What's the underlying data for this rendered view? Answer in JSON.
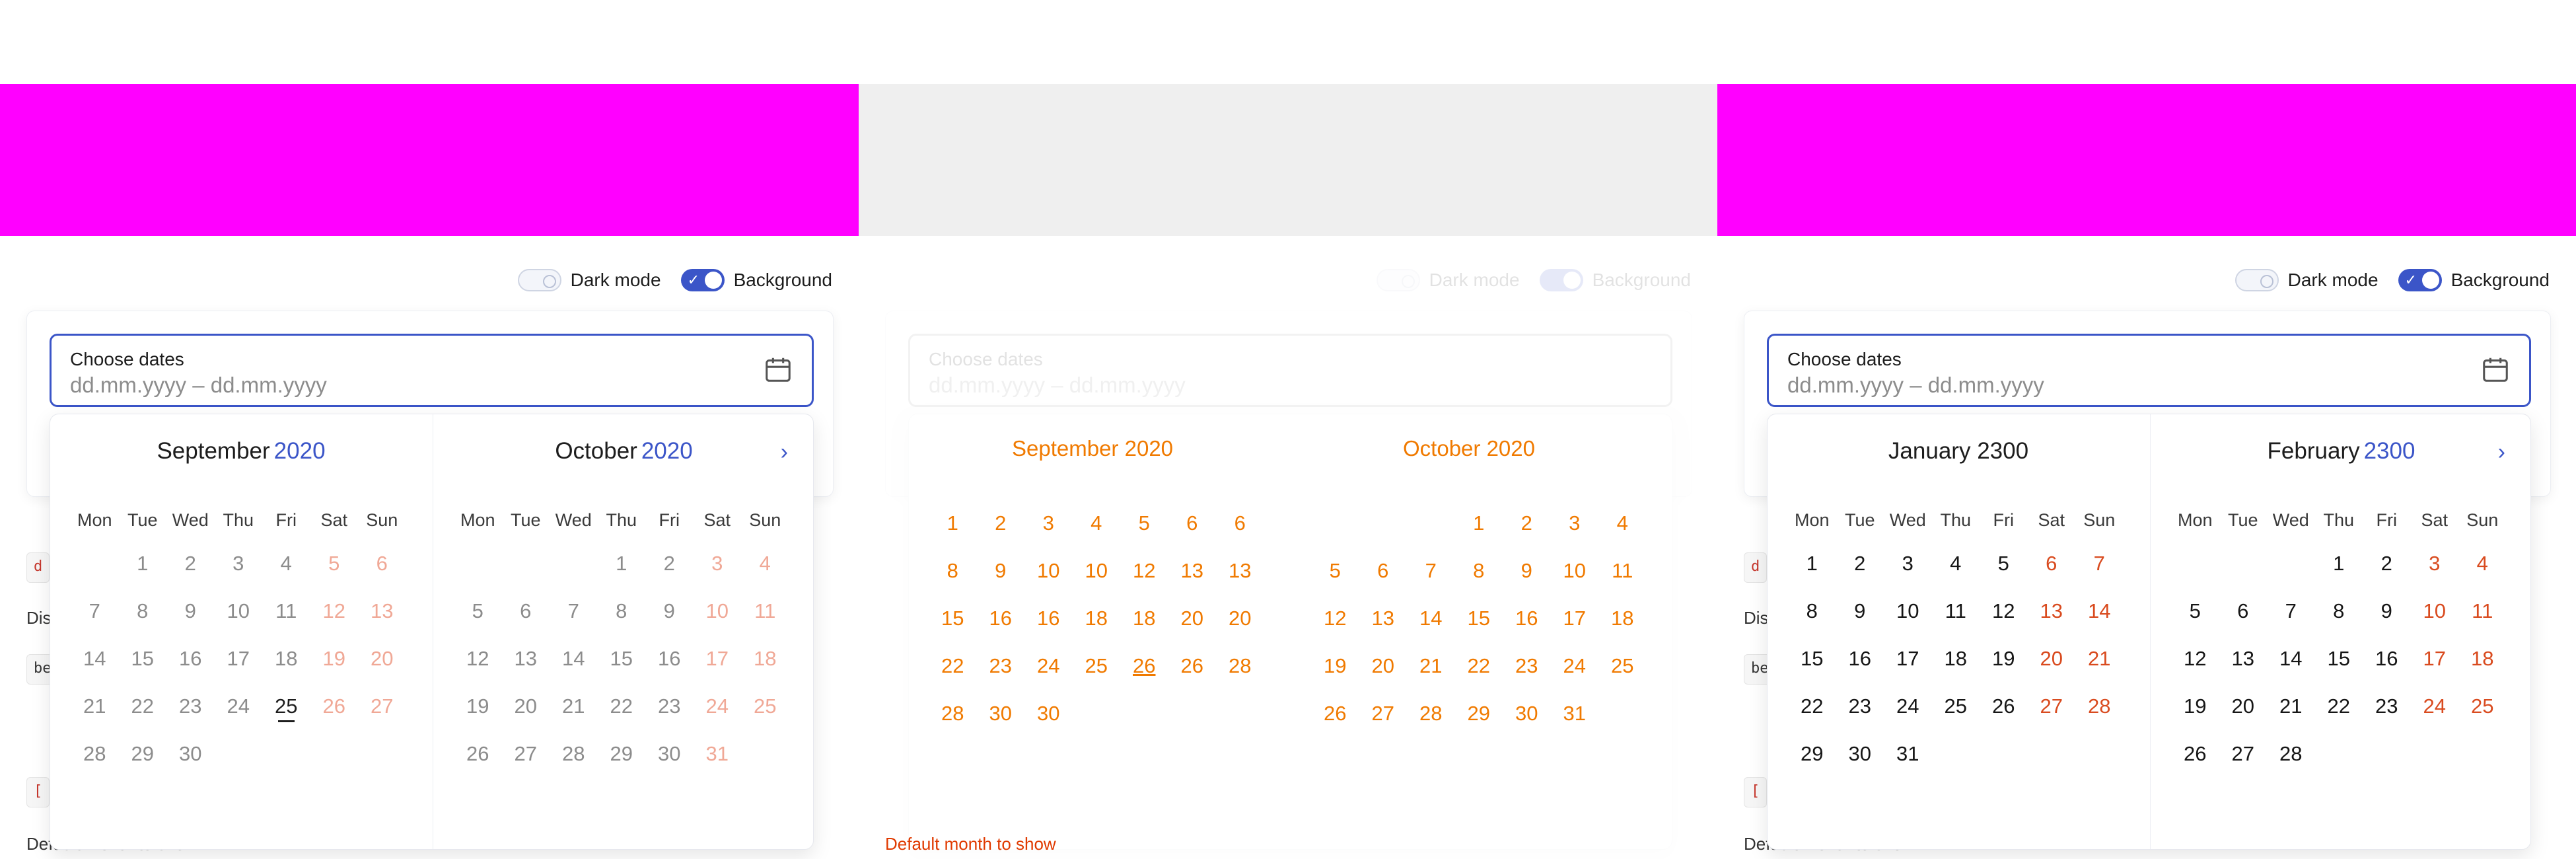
{
  "colors": {
    "accent": "#3b55c8",
    "weekend": "#d94b1f",
    "banner_magenta": "#ff00ff",
    "banner_gray": "#efefef"
  },
  "toggles": {
    "dark_mode": "Dark mode",
    "background": "Background"
  },
  "field": {
    "label": "Choose dates",
    "placeholder": "dd.mm.yyyy – dd.mm.yyyy"
  },
  "below": {
    "line1": "Dis",
    "line2": "Default month to show"
  },
  "weekdays": [
    "Mon",
    "Tue",
    "Wed",
    "Thu",
    "Fri",
    "Sat",
    "Sun"
  ],
  "panels": [
    {
      "left": {
        "month": "September",
        "year": "2020"
      },
      "right": {
        "month": "October",
        "year": "2020"
      }
    },
    {
      "left": {
        "month": "September",
        "year": "2020"
      },
      "right": {
        "month": "October",
        "year": "2020"
      }
    },
    {
      "left": {
        "month": "January",
        "year": "2300"
      },
      "right": {
        "month": "February",
        "year": "2300"
      }
    }
  ],
  "icons": {
    "calendar": "calendar-icon",
    "next": "chevron-right-icon"
  }
}
